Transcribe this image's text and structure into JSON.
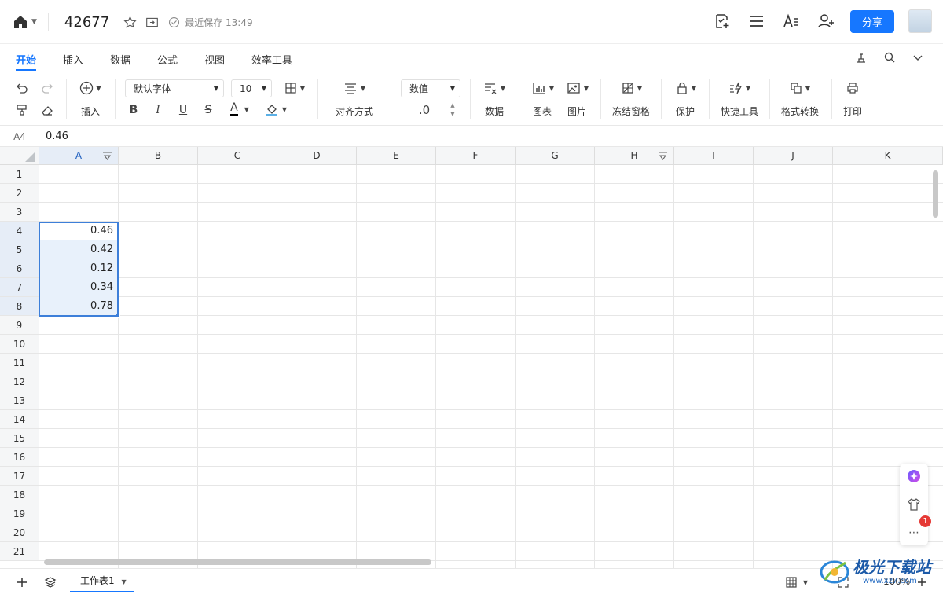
{
  "header": {
    "doc_title": "42677",
    "saved_status": "最近保存 13:49",
    "share_label": "分享"
  },
  "menu": {
    "tabs": [
      "开始",
      "插入",
      "数据",
      "公式",
      "视图",
      "效率工具"
    ],
    "active_tab": "开始"
  },
  "toolbar": {
    "insert_label": "插入",
    "font_name": "默认字体",
    "font_size": "10",
    "align_label": "对齐方式",
    "number_format": "数值",
    "decimal": ".0",
    "data_label": "数据",
    "chart_label": "图表",
    "image_label": "图片",
    "freeze_label": "冻结窗格",
    "protect_label": "保护",
    "quick_tools_label": "快捷工具",
    "format_convert_label": "格式转换",
    "print_label": "打印"
  },
  "formula_bar": {
    "cell_ref": "A4",
    "value": "0.46"
  },
  "sheet": {
    "columns": [
      "A",
      "B",
      "C",
      "D",
      "E",
      "F",
      "G",
      "H",
      "I",
      "J",
      "K"
    ],
    "rows": [
      "1",
      "2",
      "3",
      "4",
      "5",
      "6",
      "7",
      "8",
      "9",
      "10",
      "11",
      "12",
      "13",
      "14",
      "15",
      "16",
      "17",
      "18",
      "19",
      "20",
      "21"
    ],
    "cells_A": [
      {
        "row": "4",
        "value": "0.46"
      },
      {
        "row": "5",
        "value": "0.42"
      },
      {
        "row": "6",
        "value": "0.12"
      },
      {
        "row": "7",
        "value": "0.34"
      },
      {
        "row": "8",
        "value": "0.78"
      }
    ]
  },
  "side_panel": {
    "badge_count": "1"
  },
  "footer": {
    "sheet_tab": "工作表1",
    "zoom": "100%"
  },
  "watermark": {
    "name": "极光下载站",
    "url": "www.xz7.com"
  },
  "colors": {
    "accent": "#1677ff",
    "selection": "#3d7fd9",
    "selection_fill": "#e8f1fb"
  }
}
